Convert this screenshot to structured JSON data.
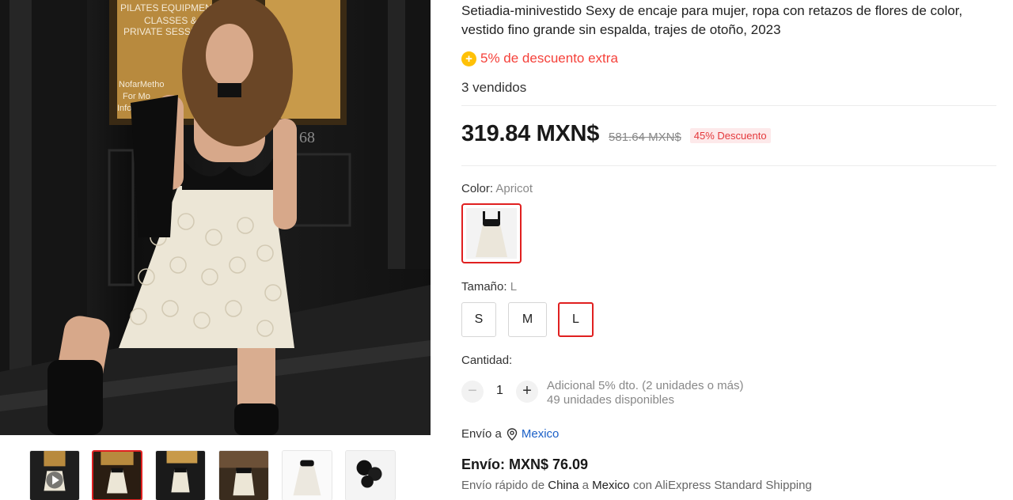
{
  "product": {
    "title": "Setiadia-minivestido Sexy de encaje para mujer, ropa con retazos de flores de color, vestido fino grande sin espalda, trajes de otoño, 2023",
    "promo_icon": "+",
    "promo_text": "5% de descuento extra",
    "sold": "3 vendidos"
  },
  "price": {
    "current": "319.84 MXN$",
    "original": "581.64 MXN$",
    "discount": "45% Descuento"
  },
  "photo": {
    "storefront_text": [
      "PILATES EQUIPMEN",
      "CLASSES &",
      "PRIVATE SESSIO",
      "NofarMetho",
      "For Mo",
      "Info@N"
    ],
    "door_number": "68"
  },
  "color": {
    "label": "Color: ",
    "value": "Apricot"
  },
  "size": {
    "label": "Tamaño: ",
    "value": "L",
    "options": [
      "S",
      "M",
      "L"
    ]
  },
  "quantity": {
    "label": "Cantidad:",
    "minus": "−",
    "plus": "+",
    "value": "1",
    "note_line1": "Adicional 5% dto. (2 unidades o más)",
    "note_line2": "49 unidades disponibles"
  },
  "shipping": {
    "to_label": "Envío a",
    "country": "Mexico",
    "cost": "Envío: MXN$ 76.09",
    "desc_prefix": "Envío rápido de ",
    "from": "China",
    "desc_mid": " a ",
    "to": "Mexico",
    "desc_suffix": " con AliExpress Standard Shipping"
  },
  "colors": {
    "accent": "#e02020",
    "price_red": "#f5413a",
    "link_blue": "#1a5fc7",
    "promo_yellow": "#ffc107"
  }
}
